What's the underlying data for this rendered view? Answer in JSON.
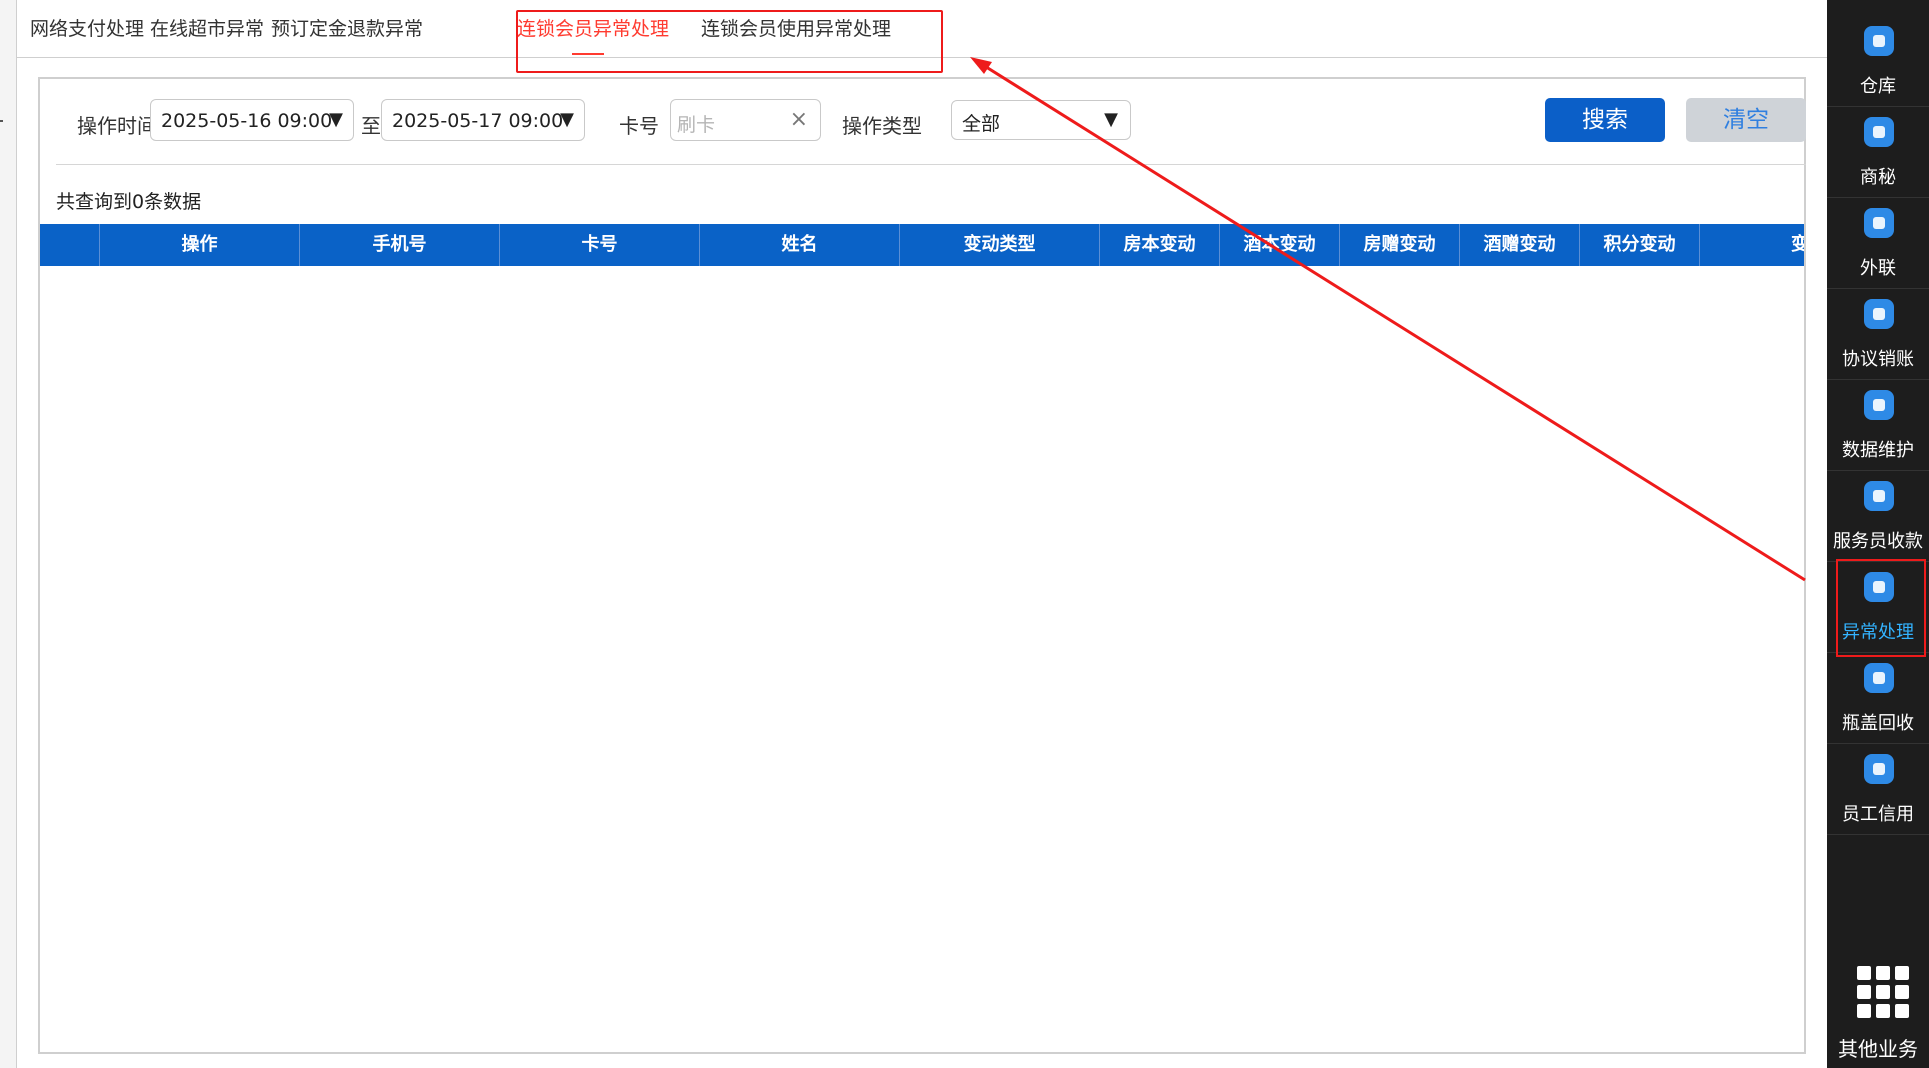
{
  "tabs": [
    {
      "label": "网络支付处理",
      "active": false
    },
    {
      "label": "在线超市异常",
      "active": false
    },
    {
      "label": "预订定金退款异常",
      "active": false
    },
    {
      "label": "连锁会员异常处理",
      "active": true
    },
    {
      "label": "连锁会员使用异常处理",
      "active": false
    }
  ],
  "filters": {
    "time_label": "操作时间",
    "start_time": "2025-05-16 09:00",
    "to_label": "至",
    "end_time": "2025-05-17 09:00",
    "card_label": "卡号",
    "card_placeholder": "刷卡",
    "op_type_label": "操作类型",
    "op_type_value": "全部",
    "search_button": "搜索",
    "clear_button": "清空"
  },
  "result_count_text": "共查询到0条数据",
  "table": {
    "columns": [
      "",
      "操作",
      "手机号",
      "卡号",
      "姓名",
      "变动类型",
      "房本变动",
      "酒本变动",
      "房赠变动",
      "酒赠变动",
      "积分变动",
      "变"
    ],
    "rows": []
  },
  "sidebar": {
    "top_partial_label": "",
    "items": [
      {
        "label": "仓库",
        "icon": "warehouse-icon",
        "active": false
      },
      {
        "label": "商秘",
        "icon": "download-icon",
        "active": false
      },
      {
        "label": "外联",
        "icon": "contact-icon",
        "active": false
      },
      {
        "label": "协议销账",
        "icon": "download-icon",
        "active": false
      },
      {
        "label": "数据维护",
        "icon": "pie-chart-icon",
        "active": false
      },
      {
        "label": "服务员收款",
        "icon": "person-icon",
        "active": false
      },
      {
        "label": "异常处理",
        "icon": "box-icon",
        "active": true
      },
      {
        "label": "瓶盖回收",
        "icon": "recycle-icon",
        "active": false
      },
      {
        "label": "员工信用",
        "icon": "credit-icon",
        "active": false
      }
    ],
    "other_label": "其他业务"
  },
  "colors": {
    "accent_red": "#ff3b30",
    "header_blue": "#0a62c7",
    "search_blue": "#0b5fc8",
    "sidebar_bg": "#1d1d1d",
    "sidebar_active": "#33b3ff"
  }
}
